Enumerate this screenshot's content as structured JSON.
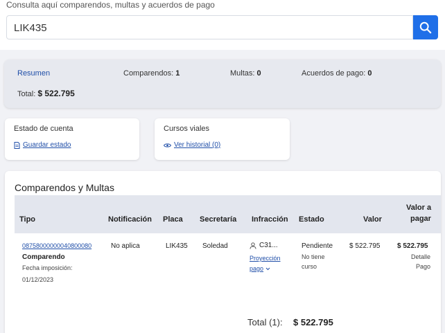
{
  "search": {
    "hint": "Consulta aquí comparendos, multas y acuerdos de pago",
    "value": "LIK435"
  },
  "summary": {
    "title": "Resumen",
    "comparendos_label": "Comparendos:",
    "comparendos_value": "1",
    "multas_label": "Multas:",
    "multas_value": "0",
    "acuerdos_label": "Acuerdos de pago:",
    "acuerdos_value": "0",
    "total_label": "Total:",
    "total_value": "$ 522.795"
  },
  "estado_cuenta": {
    "title": "Estado de cuenta",
    "link": "Guardar estado"
  },
  "cursos": {
    "title": "Cursos viales",
    "link": "Ver historial (0)"
  },
  "table": {
    "heading": "Comparendos y Multas",
    "headers": {
      "tipo": "Tipo",
      "notificacion": "Notificación",
      "placa": "Placa",
      "secretaria": "Secretaría",
      "infraccion": "Infracción",
      "estado": "Estado",
      "valor": "Valor",
      "valor_pagar_1": "Valor a",
      "valor_pagar_2": "pagar"
    },
    "row": {
      "numero": "08758000000040800080",
      "tipo": "Comparendo",
      "fecha_label": "Fecha imposición:",
      "fecha": "01/12/2023",
      "notificacion": "No aplica",
      "placa": "LIK435",
      "secretaria": "Soledad",
      "infraccion": "C31...",
      "proyeccion_1": "Proyección",
      "proyeccion_2": "pago",
      "estado": "Pendiente",
      "curso_1": "No tiene",
      "curso_2": "curso",
      "valor": "$ 522.795",
      "valor_pagar": "$ 522.795",
      "detalle": "Detalle",
      "pago": "Pago"
    },
    "total_label": "Total (1):",
    "total_value": "$ 522.795"
  },
  "colors": {
    "accent": "#1f6fe8",
    "link": "#1f4ea8"
  }
}
